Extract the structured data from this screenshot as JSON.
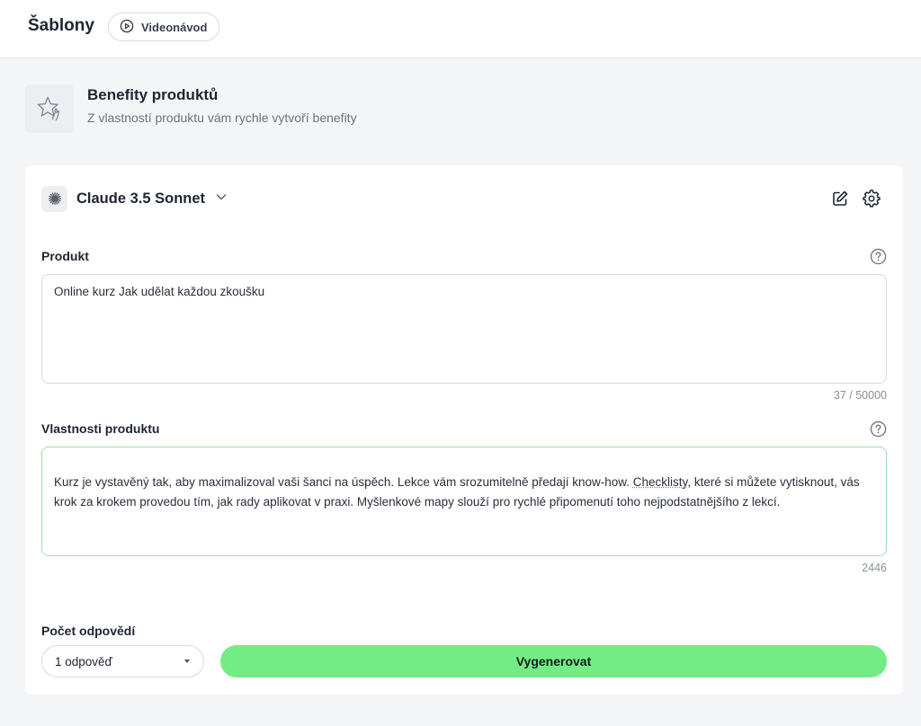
{
  "header": {
    "title": "Šablony",
    "video_button": "Videonávod"
  },
  "template": {
    "title": "Benefity produktů",
    "subtitle": "Z vlastností produktu vám rychle vytvoří benefity",
    "icon": "star-hand-icon"
  },
  "model": {
    "name": "Claude 3.5 Sonnet",
    "icon": "claude-logo-icon"
  },
  "product_field": {
    "label": "Produkt",
    "value": "Online kurz Jak udělat každou zkoušku",
    "counter": "37 / 50000"
  },
  "properties_field": {
    "label": "Vlastnosti produktu",
    "text_before": "Kurz je vystavěný tak, aby maximalizoval vaši šanci na úspěch. Lekce vám srozumitelně předají know-how. ",
    "text_flagged": "Checklisty",
    "text_after": ", které si můžete vytisknout, vás krok za krokem provedou tím, jak rady aplikovat v praxi. Myšlenkové mapy slouží pro rychlé připomenutí toho nejpodstatnějšího z lekcí.",
    "counter": "2446"
  },
  "answers": {
    "label": "Počet odpovědí",
    "selected": "1 odpověď"
  },
  "generate_button": "Vygenerovat",
  "colors": {
    "accent": "#74ec85",
    "focus_border": "#9fe0a8",
    "page_bg": "#f4f5f7"
  }
}
